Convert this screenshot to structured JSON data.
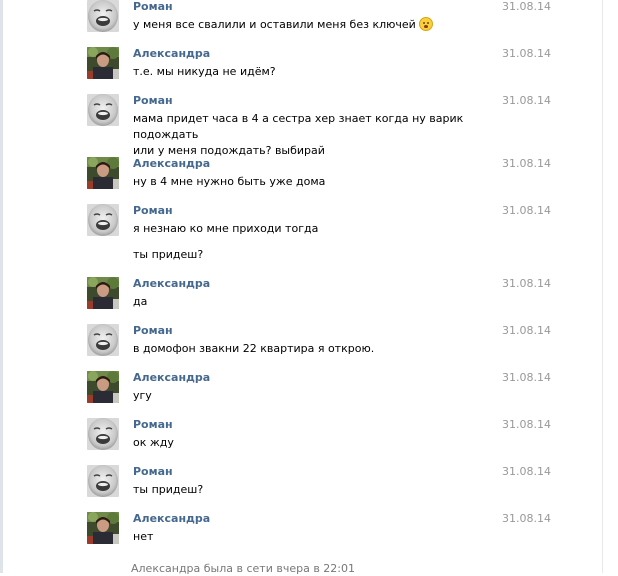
{
  "users": {
    "roman": "Роман",
    "alexandra": "Александра"
  },
  "messages": [
    {
      "author": "Роман",
      "date": "31.08.14",
      "text": "у меня все свалили и оставили меня без ключей",
      "emoji": "crying-face-icon"
    },
    {
      "author": "Александра",
      "date": "31.08.14",
      "text": "т.е. мы никуда не идём?"
    },
    {
      "author": "Роман",
      "date": "31.08.14",
      "text": "мама придет часа в 4 а сестра хер знает когда ну варик подождать\nили у меня подождать? выбирай"
    },
    {
      "author": "Александра",
      "date": "31.08.14",
      "text": "ну в 4 мне нужно быть уже дома"
    },
    {
      "author": "Роман",
      "date": "31.08.14",
      "text": "я незнаю ко мне приходи тогда",
      "extra": "ты придеш?"
    },
    {
      "author": "Александра",
      "date": "31.08.14",
      "text": "да"
    },
    {
      "author": "Роман",
      "date": "31.08.14",
      "text": "в домофон звакни 22 квартира я открою."
    },
    {
      "author": "Александра",
      "date": "31.08.14",
      "text": "угу"
    },
    {
      "author": "Роман",
      "date": "31.08.14",
      "text": "ок жду"
    },
    {
      "author": "Роман",
      "date": "31.08.14",
      "text": "ты придеш?"
    },
    {
      "author": "Александра",
      "date": "31.08.14",
      "text": "нет"
    }
  ],
  "status_line": "Александра была в сети вчера в 22:01",
  "colors": {
    "author_link": "#45688e",
    "date": "#999999",
    "status": "#777777"
  }
}
